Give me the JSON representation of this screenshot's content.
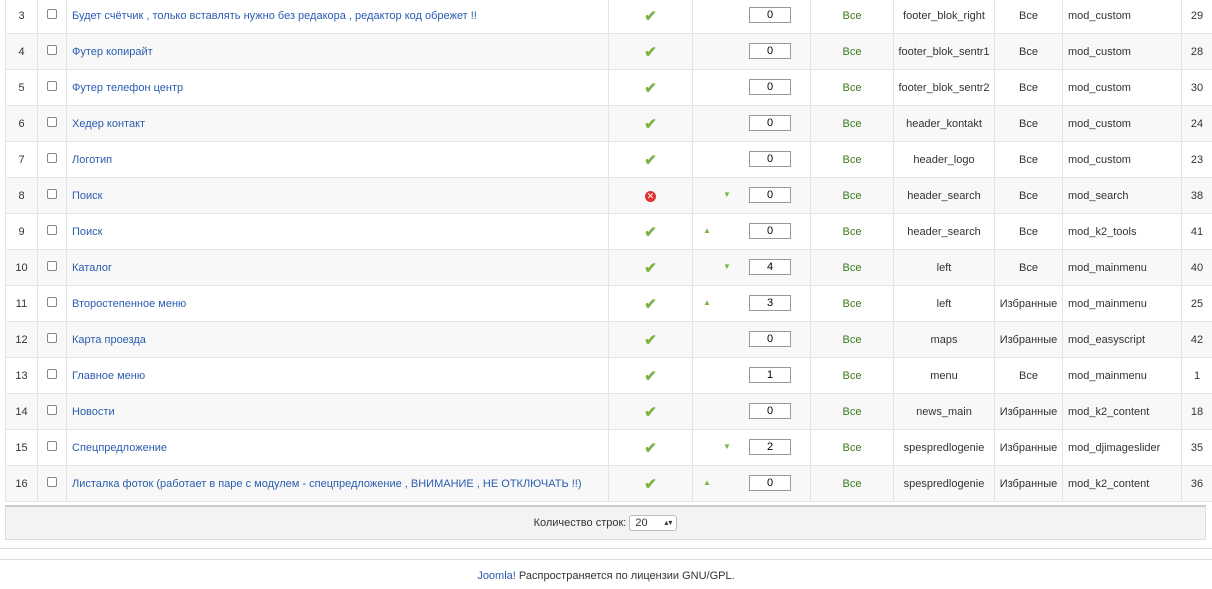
{
  "rows": [
    {
      "n": "3",
      "title": "Будет счётчик , только вставлять нужно без редакора , редактор код обрежет !!",
      "status": "published",
      "arrow": "",
      "order": "0",
      "pages": "Все",
      "position": "footer_blok_right",
      "access": "Все",
      "type": "mod_custom",
      "id": "29"
    },
    {
      "n": "4",
      "title": "Футер копирайт",
      "status": "published",
      "arrow": "",
      "order": "0",
      "pages": "Все",
      "position": "footer_blok_sentr1",
      "access": "Все",
      "type": "mod_custom",
      "id": "28"
    },
    {
      "n": "5",
      "title": "Футер телефон центр",
      "status": "published",
      "arrow": "",
      "order": "0",
      "pages": "Все",
      "position": "footer_blok_sentr2",
      "access": "Все",
      "type": "mod_custom",
      "id": "30"
    },
    {
      "n": "6",
      "title": "Хедер контакт",
      "status": "published",
      "arrow": "",
      "order": "0",
      "pages": "Все",
      "position": "header_kontakt",
      "access": "Все",
      "type": "mod_custom",
      "id": "24"
    },
    {
      "n": "7",
      "title": "Логотип",
      "status": "published",
      "arrow": "",
      "order": "0",
      "pages": "Все",
      "position": "header_logo",
      "access": "Все",
      "type": "mod_custom",
      "id": "23"
    },
    {
      "n": "8",
      "title": "Поиск",
      "status": "unpublished",
      "arrow": "down",
      "order": "0",
      "pages": "Все",
      "position": "header_search",
      "access": "Все",
      "type": "mod_search",
      "id": "38"
    },
    {
      "n": "9",
      "title": "Поиск",
      "status": "published",
      "arrow": "up",
      "order": "0",
      "pages": "Все",
      "position": "header_search",
      "access": "Все",
      "type": "mod_k2_tools",
      "id": "41"
    },
    {
      "n": "10",
      "title": "Каталог",
      "status": "published",
      "arrow": "down",
      "order": "4",
      "pages": "Все",
      "position": "left",
      "access": "Все",
      "type": "mod_mainmenu",
      "id": "40"
    },
    {
      "n": "11",
      "title": "Второстепенное меню",
      "status": "published",
      "arrow": "up",
      "order": "3",
      "pages": "Все",
      "position": "left",
      "access": "Избранные",
      "type": "mod_mainmenu",
      "id": "25"
    },
    {
      "n": "12",
      "title": "Карта проезда",
      "status": "published",
      "arrow": "",
      "order": "0",
      "pages": "Все",
      "position": "maps",
      "access": "Избранные",
      "type": "mod_easyscript",
      "id": "42"
    },
    {
      "n": "13",
      "title": "Главное меню",
      "status": "published",
      "arrow": "",
      "order": "1",
      "pages": "Все",
      "position": "menu",
      "access": "Все",
      "type": "mod_mainmenu",
      "id": "1"
    },
    {
      "n": "14",
      "title": "Новости",
      "status": "published",
      "arrow": "",
      "order": "0",
      "pages": "Все",
      "position": "news_main",
      "access": "Избранные",
      "type": "mod_k2_content",
      "id": "18"
    },
    {
      "n": "15",
      "title": "Спецпредложение",
      "status": "published",
      "arrow": "down",
      "order": "2",
      "pages": "Все",
      "position": "spespredlogenie",
      "access": "Избранные",
      "type": "mod_djimageslider",
      "id": "35"
    },
    {
      "n": "16",
      "title": "Листалка фоток (работает в паре с модулем - спецпредложение , ВНИМАНИЕ , НЕ ОТКЛЮЧАТЬ !!)",
      "status": "published",
      "arrow": "up",
      "order": "0",
      "pages": "Все",
      "position": "spespredlogenie",
      "access": "Избранные",
      "type": "mod_k2_content",
      "id": "36"
    }
  ],
  "pagination": {
    "label": "Количество строк:",
    "value": "20"
  },
  "footer": {
    "link": "Joomla!",
    "text": " Распространяется по лицензии GNU/GPL."
  }
}
